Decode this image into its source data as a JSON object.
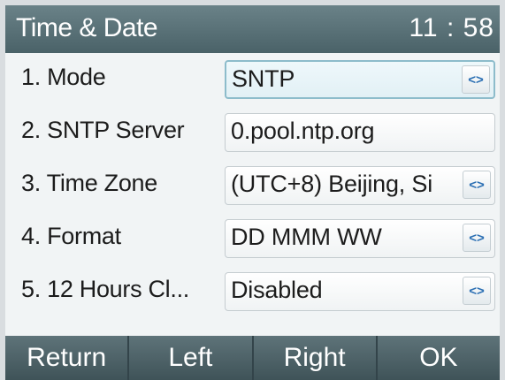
{
  "header": {
    "title": "Time & Date",
    "clock": "11 : 58"
  },
  "items": [
    {
      "label": "1.  Mode",
      "value": "SNTP",
      "has_selector": true,
      "active": true
    },
    {
      "label": "2.  SNTP Server",
      "value": "0.pool.ntp.org",
      "has_selector": false
    },
    {
      "label": "3.  Time Zone",
      "value": "(UTC+8) Beijing, Si",
      "has_selector": true
    },
    {
      "label": "4.  Format",
      "value": "DD MMM WW",
      "has_selector": true
    },
    {
      "label": "5.  12 Hours Cl...",
      "value": "Disabled",
      "has_selector": true
    }
  ],
  "selector_glyph": "<>",
  "softkeys": {
    "return": "Return",
    "left": "Left",
    "right": "Right",
    "ok": "OK"
  }
}
